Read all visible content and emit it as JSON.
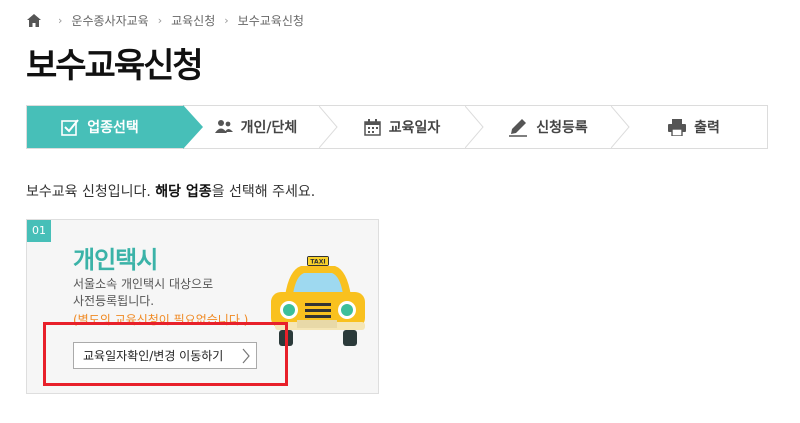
{
  "breadcrumb": {
    "items": [
      "운수종사자교육",
      "교육신청",
      "보수교육신청"
    ]
  },
  "page": {
    "title": "보수교육신청"
  },
  "steps": [
    {
      "label": "업종선택",
      "icon": "checkbox-icon",
      "active": true
    },
    {
      "label": "개인/단체",
      "icon": "users-icon",
      "active": false
    },
    {
      "label": "교육일자",
      "icon": "calendar-icon",
      "active": false
    },
    {
      "label": "신청등록",
      "icon": "pencil-icon",
      "active": false
    },
    {
      "label": "출력",
      "icon": "printer-icon",
      "active": false
    }
  ],
  "intro": {
    "pre": "보수교육 신청입니다. ",
    "bold": "해당 업종",
    "post": "을 선택해 주세요."
  },
  "card": {
    "number": "01",
    "title": "개인택시",
    "desc_line1": "서울소속 개인택시 대상으로",
    "desc_line2": "사전등록됩니다.",
    "note": "(별도의 교육신청이 필요없습니다.)",
    "button_label": "교육일자확인/변경 이동하기",
    "taxi_sign": "TAXI"
  },
  "colors": {
    "accent": "#47bfb8",
    "highlight": "#e8202a",
    "note": "#f08a24"
  }
}
